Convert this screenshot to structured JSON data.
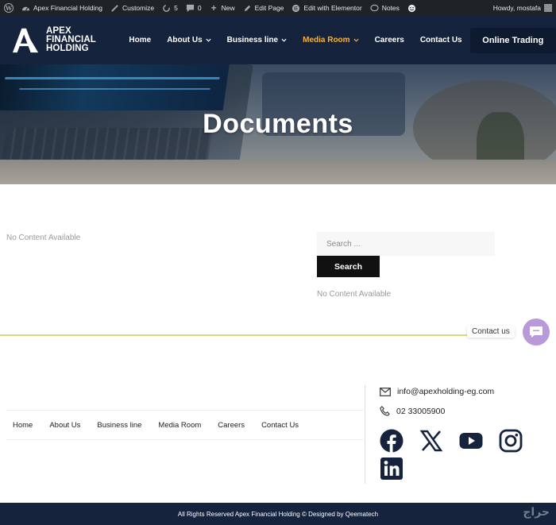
{
  "adminbar": {
    "site_name": "Apex Financial Holding",
    "customize": "Customize",
    "updates_count": "5",
    "comments_count": "0",
    "new": "New",
    "edit_page": "Edit Page",
    "edit_elementor": "Edit with Elementor",
    "notes": "Notes",
    "howdy": "Howdy, mostafa"
  },
  "header": {
    "logo_line1": "APEX",
    "logo_line2": "FINANCIAL",
    "logo_line3": "HOLDING",
    "nav": [
      {
        "label": "Home"
      },
      {
        "label": "About Us"
      },
      {
        "label": "Business line"
      },
      {
        "label": "Media Room"
      },
      {
        "label": "Careers"
      },
      {
        "label": "Contact Us"
      }
    ],
    "cta": "Online Trading",
    "accent": "#f2b33d",
    "bg": "#15233c"
  },
  "hero": {
    "title": "Documents"
  },
  "main": {
    "no_content": "No Content Available",
    "search_placeholder": "Search ...",
    "search_button": "Search",
    "sidebar_no_content": "No Content Available"
  },
  "chat": {
    "label": "Contact us",
    "color": "#b89ad9"
  },
  "footer": {
    "nav": [
      {
        "label": "Home"
      },
      {
        "label": "About Us"
      },
      {
        "label": "Business line"
      },
      {
        "label": "Media Room"
      },
      {
        "label": "Careers"
      },
      {
        "label": "Contact Us"
      }
    ],
    "email": "info@apexholding-eg.com",
    "phone": "02 33005900",
    "social": [
      "facebook-icon",
      "x-icon",
      "youtube-icon",
      "instagram-icon",
      "linkedin-icon"
    ],
    "copyright": "All Rights Reserved Apex Financial Holding © Designed by  Qeematech"
  }
}
